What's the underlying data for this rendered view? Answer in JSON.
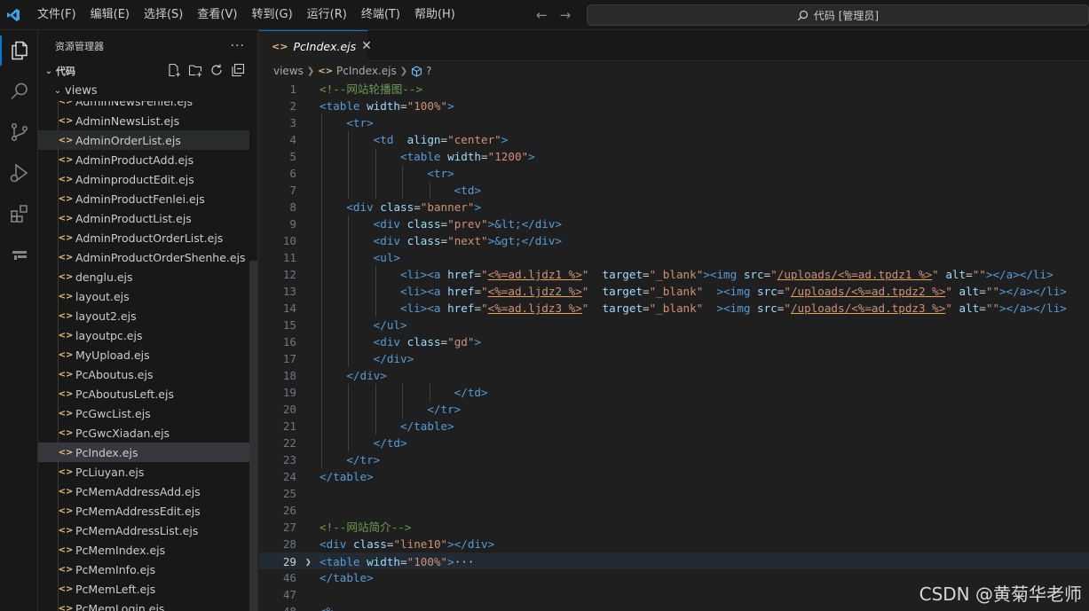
{
  "menu": [
    "文件(F)",
    "编辑(E)",
    "选择(S)",
    "查看(V)",
    "转到(G)",
    "运行(R)",
    "终端(T)",
    "帮助(H)"
  ],
  "command_center": "代码 [管理员]",
  "sidebar": {
    "title": "资源管理器",
    "more": "···",
    "folder": "代码",
    "subfolder": "views",
    "partial_top": "AdminNewsFenlei.ejs",
    "files": [
      "AdminNewsList.ejs",
      "AdminOrderList.ejs",
      "AdminProductAdd.ejs",
      "AdminproductEdit.ejs",
      "AdminProductFenlei.ejs",
      "AdminProductList.ejs",
      "AdminProductOrderList.ejs",
      "AdminProductOrderShenhe.ejs",
      "denglu.ejs",
      "layout.ejs",
      "layout2.ejs",
      "layoutpc.ejs",
      "MyUpload.ejs",
      "PcAboutus.ejs",
      "PcAboutusLeft.ejs",
      "PcGwcList.ejs",
      "PcGwcXiadan.ejs",
      "PcIndex.ejs",
      "PcLiuyan.ejs",
      "PcMemAddressAdd.ejs",
      "PcMemAddressEdit.ejs",
      "PcMemAddressList.ejs",
      "PcMemIndex.ejs",
      "PcMemInfo.ejs",
      "PcMemLeft.ejs",
      "PcMemLogin.ejs"
    ],
    "hover_index": 1,
    "selected_index": 17
  },
  "editor": {
    "tab_label": "PcIndex.ejs",
    "close_glyph": "✕",
    "breadcrumb": [
      "views",
      "PcIndex.ejs",
      "?"
    ],
    "lines": [
      {
        "n": "1",
        "depth": 0,
        "html": "<span class=\"c-comment\">&lt;!--网站轮播图--&gt;</span>"
      },
      {
        "n": "2",
        "depth": 0,
        "html": "<span class=\"c-tag\">&lt;table</span> <span class=\"c-attr\">width</span><span class=\"c-text\">=</span><span class=\"c-str\">\"100%\"</span><span class=\"c-tag\">&gt;</span>"
      },
      {
        "n": "3",
        "depth": 1,
        "html": "    <span class=\"c-tag\">&lt;tr&gt;</span>"
      },
      {
        "n": "4",
        "depth": 2,
        "html": "        <span class=\"c-tag\">&lt;td</span>  <span class=\"c-attr\">align</span><span class=\"c-text\">=</span><span class=\"c-str\">\"center\"</span><span class=\"c-tag\">&gt;</span>"
      },
      {
        "n": "5",
        "depth": 3,
        "html": "            <span class=\"c-tag\">&lt;table</span> <span class=\"c-attr\">width</span><span class=\"c-text\">=</span><span class=\"c-str\">\"1200\"</span><span class=\"c-tag\">&gt;</span>"
      },
      {
        "n": "6",
        "depth": 4,
        "html": "                <span class=\"c-tag\">&lt;tr&gt;</span>"
      },
      {
        "n": "7",
        "depth": 5,
        "html": "                    <span class=\"c-tag\">&lt;td&gt;</span>"
      },
      {
        "n": "8",
        "depth": 1,
        "html": "    <span class=\"c-tag\">&lt;div</span> <span class=\"c-attr\">class</span><span class=\"c-text\">=</span><span class=\"c-str\">\"banner\"</span><span class=\"c-tag\">&gt;</span>"
      },
      {
        "n": "9",
        "depth": 2,
        "html": "        <span class=\"c-tag\">&lt;div</span> <span class=\"c-attr\">class</span><span class=\"c-text\">=</span><span class=\"c-str\">\"prev\"</span><span class=\"c-tag\">&gt;</span><span class=\"c-ent\">&amp;lt;</span><span class=\"c-tag\">&lt;/div&gt;</span>"
      },
      {
        "n": "10",
        "depth": 2,
        "html": "        <span class=\"c-tag\">&lt;div</span> <span class=\"c-attr\">class</span><span class=\"c-text\">=</span><span class=\"c-str\">\"next\"</span><span class=\"c-tag\">&gt;</span><span class=\"c-ent\">&amp;gt;</span><span class=\"c-tag\">&lt;/div&gt;</span>"
      },
      {
        "n": "11",
        "depth": 2,
        "html": "        <span class=\"c-tag\">&lt;ul&gt;</span>"
      },
      {
        "n": "12",
        "depth": 3,
        "html": "            <span class=\"c-tag\">&lt;li&gt;&lt;a</span> <span class=\"c-attr\">href</span><span class=\"c-text\">=</span><span class=\"c-str\">\"</span><span class=\"c-ejs\">&lt;%=ad.ljdz1 %&gt;</span><span class=\"c-str\">\"</span>  <span class=\"c-attr\">target</span><span class=\"c-text\">=</span><span class=\"c-str\">\"_blank\"</span><span class=\"c-tag\">&gt;&lt;img</span> <span class=\"c-attr\">src</span><span class=\"c-text\">=</span><span class=\"c-str\">\"</span><span class=\"c-ejs\">/uploads/&lt;%=ad.tpdz1 %&gt;</span><span class=\"c-str\">\"</span> <span class=\"c-attr\">alt</span><span class=\"c-text\">=</span><span class=\"c-str\">\"\"</span><span class=\"c-tag\">&gt;&lt;/a&gt;&lt;/li&gt;</span>"
      },
      {
        "n": "13",
        "depth": 3,
        "html": "            <span class=\"c-tag\">&lt;li&gt;&lt;a</span> <span class=\"c-attr\">href</span><span class=\"c-text\">=</span><span class=\"c-str\">\"</span><span class=\"c-ejs\">&lt;%=ad.ljdz2 %&gt;</span><span class=\"c-str\">\"</span>  <span class=\"c-attr\">target</span><span class=\"c-text\">=</span><span class=\"c-str\">\"_blank\"</span>  <span class=\"c-tag\">&gt;&lt;img</span> <span class=\"c-attr\">src</span><span class=\"c-text\">=</span><span class=\"c-str\">\"</span><span class=\"c-ejs\">/uploads/&lt;%=ad.tpdz2 %&gt;</span><span class=\"c-str\">\"</span> <span class=\"c-attr\">alt</span><span class=\"c-text\">=</span><span class=\"c-str\">\"\"</span><span class=\"c-tag\">&gt;&lt;/a&gt;&lt;/li&gt;</span>"
      },
      {
        "n": "14",
        "depth": 3,
        "html": "            <span class=\"c-tag\">&lt;li&gt;&lt;a</span> <span class=\"c-attr\">href</span><span class=\"c-text\">=</span><span class=\"c-str\">\"</span><span class=\"c-ejs\">&lt;%=ad.ljdz3 %&gt;</span><span class=\"c-str\">\"</span>  <span class=\"c-attr\">target</span><span class=\"c-text\">=</span><span class=\"c-str\">\"_blank\"</span>  <span class=\"c-tag\">&gt;&lt;img</span> <span class=\"c-attr\">src</span><span class=\"c-text\">=</span><span class=\"c-str\">\"</span><span class=\"c-ejs\">/uploads/&lt;%=ad.tpdz3 %&gt;</span><span class=\"c-str\">\"</span> <span class=\"c-attr\">alt</span><span class=\"c-text\">=</span><span class=\"c-str\">\"\"</span><span class=\"c-tag\">&gt;&lt;/a&gt;&lt;/li&gt;</span>"
      },
      {
        "n": "15",
        "depth": 2,
        "html": "        <span class=\"c-tag\">&lt;/ul&gt;</span>"
      },
      {
        "n": "16",
        "depth": 2,
        "html": "        <span class=\"c-tag\">&lt;div</span> <span class=\"c-attr\">class</span><span class=\"c-text\">=</span><span class=\"c-str\">\"gd\"</span><span class=\"c-tag\">&gt;</span>"
      },
      {
        "n": "17",
        "depth": 2,
        "html": "        <span class=\"c-tag\">&lt;/div&gt;</span>"
      },
      {
        "n": "18",
        "depth": 1,
        "html": "    <span class=\"c-tag\">&lt;/div&gt;</span>"
      },
      {
        "n": "19",
        "depth": 5,
        "html": "                    <span class=\"c-tag\">&lt;/td&gt;</span>"
      },
      {
        "n": "20",
        "depth": 4,
        "html": "                <span class=\"c-tag\">&lt;/tr&gt;</span>"
      },
      {
        "n": "21",
        "depth": 3,
        "html": "            <span class=\"c-tag\">&lt;/table&gt;</span>"
      },
      {
        "n": "22",
        "depth": 2,
        "html": "        <span class=\"c-tag\">&lt;/td&gt;</span>"
      },
      {
        "n": "23",
        "depth": 1,
        "html": "    <span class=\"c-tag\">&lt;/tr&gt;</span>"
      },
      {
        "n": "24",
        "depth": 0,
        "html": "<span class=\"c-tag\">&lt;/table&gt;</span>"
      },
      {
        "n": "25",
        "depth": 0,
        "html": ""
      },
      {
        "n": "26",
        "depth": 0,
        "html": ""
      },
      {
        "n": "27",
        "depth": 0,
        "html": "<span class=\"c-comment\">&lt;!--网站简介--&gt;</span>"
      },
      {
        "n": "28",
        "depth": 0,
        "html": "<span class=\"c-tag\">&lt;div</span> <span class=\"c-attr\">class</span><span class=\"c-text\">=</span><span class=\"c-str\">\"line10\"</span><span class=\"c-tag\">&gt;&lt;/div&gt;</span>"
      },
      {
        "n": "29",
        "depth": 0,
        "folded": true,
        "current": true,
        "html": "<span class=\"c-tag\">&lt;table</span> <span class=\"c-attr\">width</span><span class=\"c-text\">=</span><span class=\"c-str\">\"100%\"</span><span class=\"c-tag\">&gt;</span><span class=\"c-text\">···</span>"
      },
      {
        "n": "46",
        "depth": 0,
        "html": "<span class=\"c-tag\">&lt;/table&gt;</span>"
      },
      {
        "n": "47",
        "depth": 0,
        "html": ""
      },
      {
        "n": "48",
        "depth": 0,
        "html": "<span class=\"c-tag\">&lt;%</span>"
      }
    ]
  },
  "watermark": "CSDN @黄菊华老师"
}
